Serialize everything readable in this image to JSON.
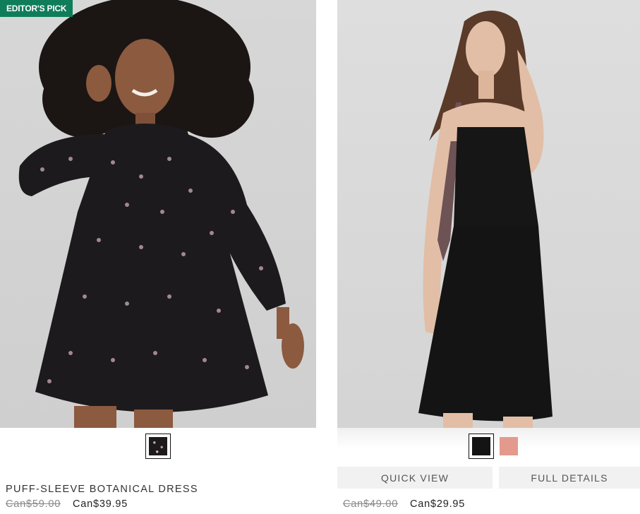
{
  "products": [
    {
      "badge": "EDITOR'S PICK",
      "name": "PUFF-SLEEVE BOTANICAL DRESS",
      "original_price": "Can$59.00",
      "sale_price": "Can$39.95",
      "swatches": [
        {
          "name": "black floral",
          "color": "#1d1a1c",
          "selected": true
        }
      ]
    },
    {
      "badge": "",
      "name": "",
      "original_price": "Can$49.00",
      "sale_price": "Can$29.95",
      "actions": {
        "quick_view": "QUICK VIEW",
        "full_details": "FULL DETAILS"
      },
      "swatches": [
        {
          "name": "black",
          "color": "#141414",
          "selected": true
        },
        {
          "name": "pink",
          "color": "#e39a8c",
          "selected": false
        }
      ]
    }
  ],
  "colors": {
    "badge_bg": "#0f7d5a",
    "action_bg": "#f1f1f1"
  }
}
